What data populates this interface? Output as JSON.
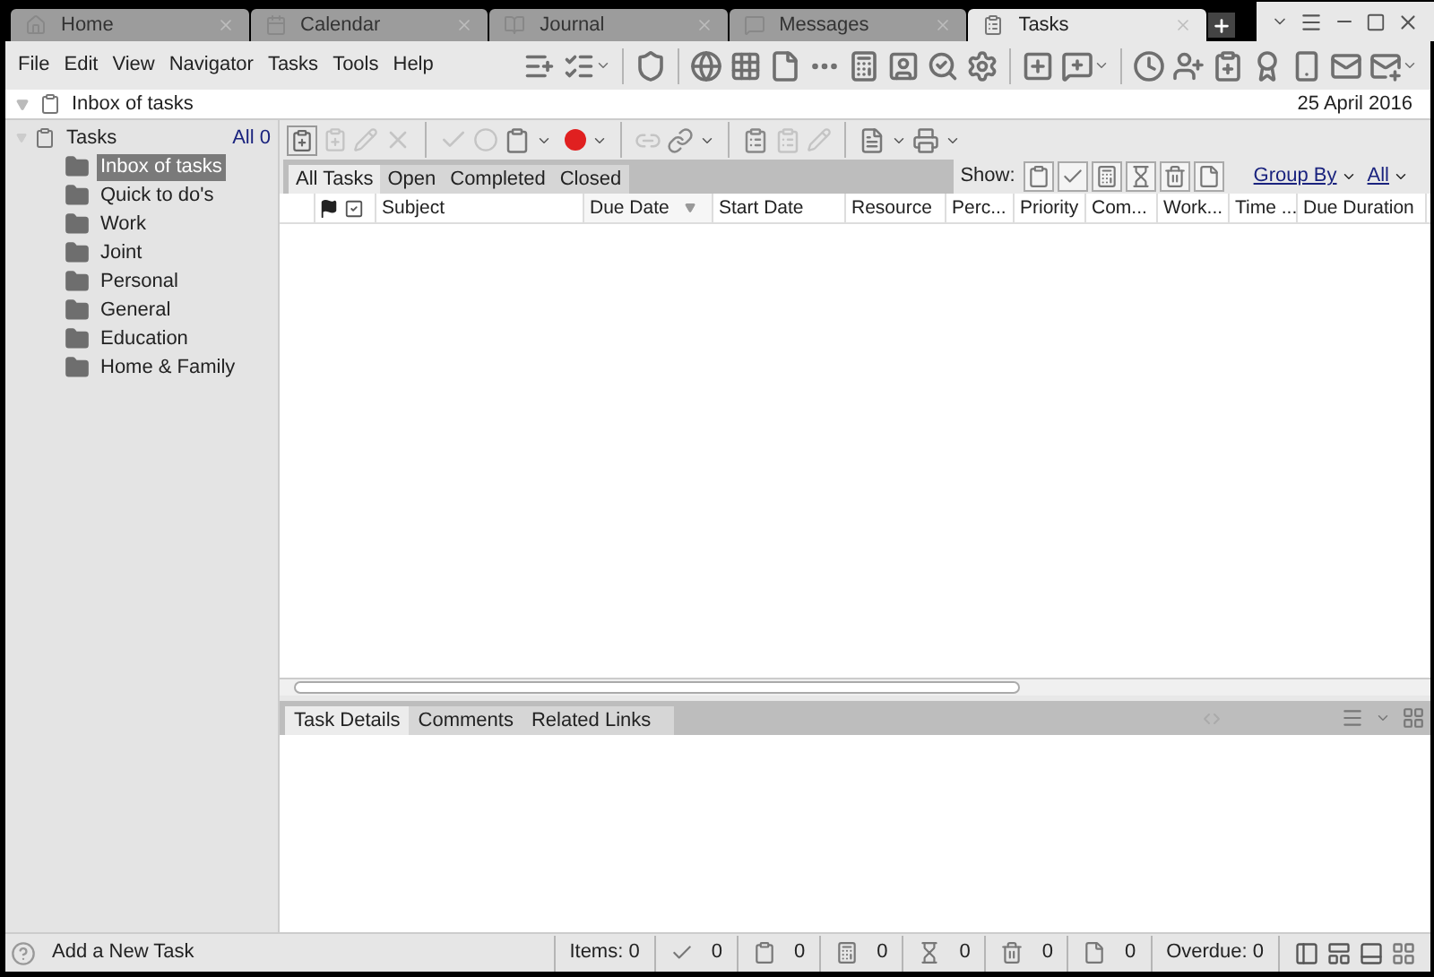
{
  "tabs": [
    {
      "label": "Home",
      "selected": false
    },
    {
      "label": "Calendar",
      "selected": false
    },
    {
      "label": "Journal",
      "selected": false
    },
    {
      "label": "Messages",
      "selected": false
    },
    {
      "label": "Tasks",
      "selected": true
    }
  ],
  "menu": [
    "File",
    "Edit",
    "View",
    "Navigator",
    "Tasks",
    "Tools",
    "Help"
  ],
  "breadcrumb": {
    "title": "Inbox of tasks",
    "date": "25 April 2016"
  },
  "tree": {
    "label": "Tasks",
    "count": "All 0",
    "expanded": true,
    "children": [
      {
        "label": "Inbox of tasks",
        "selected": true
      },
      {
        "label": "Quick to do's",
        "selected": false
      },
      {
        "label": "Work",
        "selected": false
      },
      {
        "label": "Joint",
        "selected": false
      },
      {
        "label": "Personal",
        "selected": false
      },
      {
        "label": "General",
        "selected": false
      },
      {
        "label": "Education",
        "selected": false
      },
      {
        "label": "Home & Family",
        "selected": false
      }
    ]
  },
  "task_filters": [
    {
      "label": "All Tasks",
      "selected": true
    },
    {
      "label": "Open",
      "selected": false
    },
    {
      "label": "Completed",
      "selected": false
    },
    {
      "label": "Closed",
      "selected": false
    }
  ],
  "show_label": "Show:",
  "group_by": "Group By",
  "all_filter": "All",
  "columns": [
    {
      "label": "Subject",
      "sorted": false
    },
    {
      "label": "Due Date",
      "sorted": true
    },
    {
      "label": "Start Date",
      "sorted": false
    },
    {
      "label": "Resource",
      "sorted": false
    },
    {
      "label": "Perc...",
      "sorted": false
    },
    {
      "label": "Priority",
      "sorted": false
    },
    {
      "label": "Com...",
      "sorted": false
    },
    {
      "label": "Work...",
      "sorted": false
    },
    {
      "label": "Time ...",
      "sorted": false
    },
    {
      "label": "Due Duration",
      "sorted": false
    }
  ],
  "detail_tabs": [
    {
      "label": "Task Details",
      "selected": true
    },
    {
      "label": "Comments",
      "selected": false
    },
    {
      "label": "Related Links",
      "selected": false
    }
  ],
  "status": {
    "add_task": "Add a New Task",
    "items": "Items: 0",
    "counts": [
      "0",
      "0",
      "0",
      "0",
      "0",
      "0"
    ],
    "overdue": "Overdue: 0"
  }
}
